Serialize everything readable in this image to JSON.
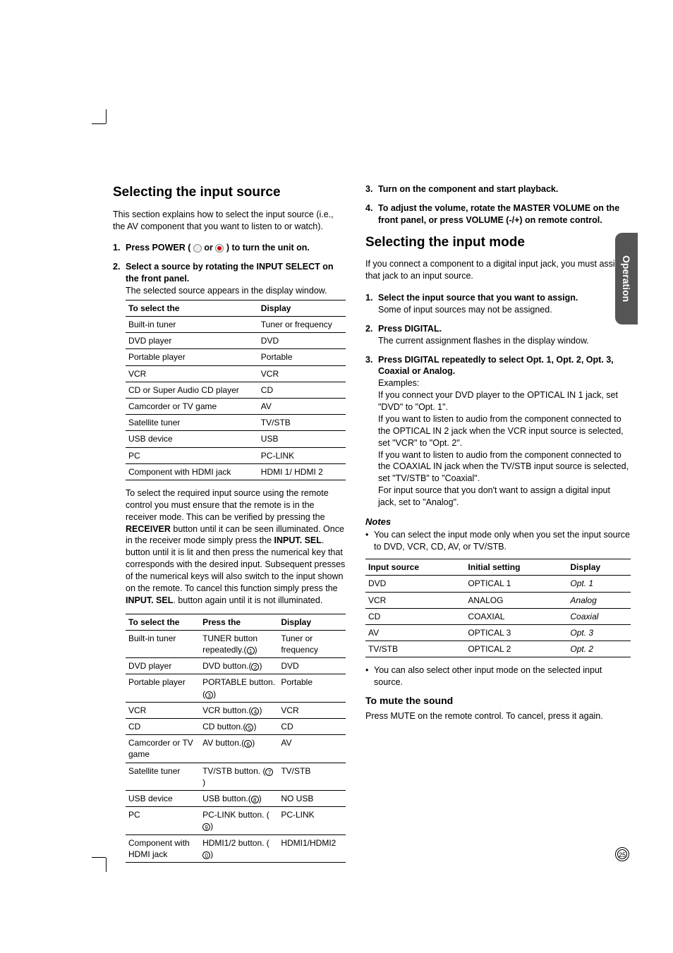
{
  "sideTab": "Operation",
  "pageNumber": "25",
  "left": {
    "h1": "Selecting the input source",
    "intro": "This section explains how to select the input source (i.e., the AV component that you want to listen to or watch).",
    "step1_pre": "Press POWER (",
    "step1_mid": " or ",
    "step1_post": " ) to turn the unit on.",
    "step2_head": "Select a source by rotating the INPUT SELECT on the front panel.",
    "step2_sub": "The selected source appears in the display window.",
    "table1": {
      "headers": [
        "To select the",
        "Display"
      ],
      "rows": [
        [
          "Built-in tuner",
          "Tuner or frequency"
        ],
        [
          "DVD player",
          "DVD"
        ],
        [
          "Portable player",
          "Portable"
        ],
        [
          "VCR",
          "VCR"
        ],
        [
          "CD or Super Audio CD player",
          "CD"
        ],
        [
          "Camcorder or TV game",
          "AV"
        ],
        [
          "Satellite tuner",
          "TV/STB"
        ],
        [
          "USB device",
          "USB"
        ],
        [
          "PC",
          "PC-LINK"
        ],
        [
          "Component with HDMI jack",
          "HDMI 1/ HDMI 2"
        ]
      ]
    },
    "paraRemote_a": "To select the required input source using the remote control you must ensure that the remote is in the receiver mode. This can be verified by pressing the ",
    "paraRemote_b": "RECEIVER",
    "paraRemote_c": " button until it can be seen illuminated. Once in the receiver mode simply press the ",
    "paraRemote_d": "INPUT. SEL",
    "paraRemote_e": ". button until it is lit and then press the numerical key that corresponds with the desired input. Subsequent presses of the numerical keys will also switch to the input shown on the remote. To cancel this function simply press the ",
    "paraRemote_f": "INPUT. SEL",
    "paraRemote_g": ". button again until it is not illuminated.",
    "table2": {
      "headers": [
        "To select the",
        "Press the",
        "Display"
      ],
      "rows": [
        {
          "c0": "Built-in tuner",
          "c1": "TUNER button repeatedly.(",
          "k": "1",
          "c1b": ")",
          "c2": "Tuner or frequency"
        },
        {
          "c0": "DVD player",
          "c1": "DVD button.(",
          "k": "2",
          "c1b": ")",
          "c2": "DVD"
        },
        {
          "c0": "Portable player",
          "c1": "PORTABLE button.(",
          "k": "3",
          "c1b": ")",
          "c2": "Portable"
        },
        {
          "c0": "VCR",
          "c1": "VCR button.(",
          "k": "4",
          "c1b": ")",
          "c2": "VCR"
        },
        {
          "c0": "CD",
          "c1": "CD button.(",
          "k": "5",
          "c1b": ")",
          "c2": "CD"
        },
        {
          "c0": "Camcorder or TV game",
          "c1": "AV button.(",
          "k": "6",
          "c1b": ")",
          "c2": "AV"
        },
        {
          "c0": "Satellite tuner",
          "c1": "TV/STB button. (",
          "k": "7",
          "c1b": ")",
          "c2": "TV/STB"
        },
        {
          "c0": "USB device",
          "c1": "USB button.(",
          "k": "8",
          "c1b": ")",
          "c2": "NO USB"
        },
        {
          "c0": "PC",
          "c1": "PC-LINK button. (",
          "k": "9",
          "c1b": ")",
          "c2": "PC-LINK"
        },
        {
          "c0": "Component with HDMI jack",
          "c1": "HDMI1/2 button. (",
          "k": "0",
          "c1b": ")",
          "c2": "HDMI1/HDMI2"
        }
      ]
    }
  },
  "right": {
    "step3": "Turn on the component and start playback.",
    "step4": "To adjust the volume, rotate the MASTER VOLUME on the front panel, or press VOLUME (-/+) on remote control.",
    "h1b": "Selecting the input mode",
    "introb": "If you connect a component to a digital input jack, you must assign that jack to an input source.",
    "b_step1_head": "Select  the input source that you want to assign.",
    "b_step1_sub": "Some of input sources may not be assigned.",
    "b_step2_head": "Press DIGITAL.",
    "b_step2_sub": "The current assignment flashes in the display window.",
    "b_step3_head": "Press DIGITAL repeatedly to select Opt. 1, Opt. 2, Opt. 3, Coaxial or Analog.",
    "b_step3_ex": "Examples:",
    "b_step3_body": "If you connect your DVD player to the OPTICAL IN 1 jack, set \"DVD\" to \"Opt. 1\".\nIf you want to listen to audio from the component connected to the OPTICAL IN 2 jack when the VCR input source is selected, set \"VCR\" to \"Opt. 2\".\nIf you want to listen to audio from the component connected to the COAXIAL IN jack when the TV/STB input source is selected, set \"TV/STB\" to \"Coaxial\".\nFor input source that you don't want to assign a digital input jack, set to \"Analog\".",
    "notesHead": "Notes",
    "note1": "You can select the input mode only when you set the input source to DVD, VCR, CD, AV, or TV/STB.",
    "table3": {
      "headers": [
        "Input source",
        "Initial setting",
        "Display"
      ],
      "rows": [
        [
          "DVD",
          "OPTICAL 1",
          "Opt. 1"
        ],
        [
          "VCR",
          "ANALOG",
          "Analog"
        ],
        [
          "CD",
          "COAXIAL",
          "Coaxial"
        ],
        [
          "AV",
          "OPTICAL 3",
          "Opt. 3"
        ],
        [
          "TV/STB",
          "OPTICAL 2",
          "Opt. 2"
        ]
      ]
    },
    "note2": "You can also select other input mode on the selected input source.",
    "muteHead": "To mute the sound",
    "muteBody": "Press MUTE on the remote control. To cancel, press it again."
  }
}
